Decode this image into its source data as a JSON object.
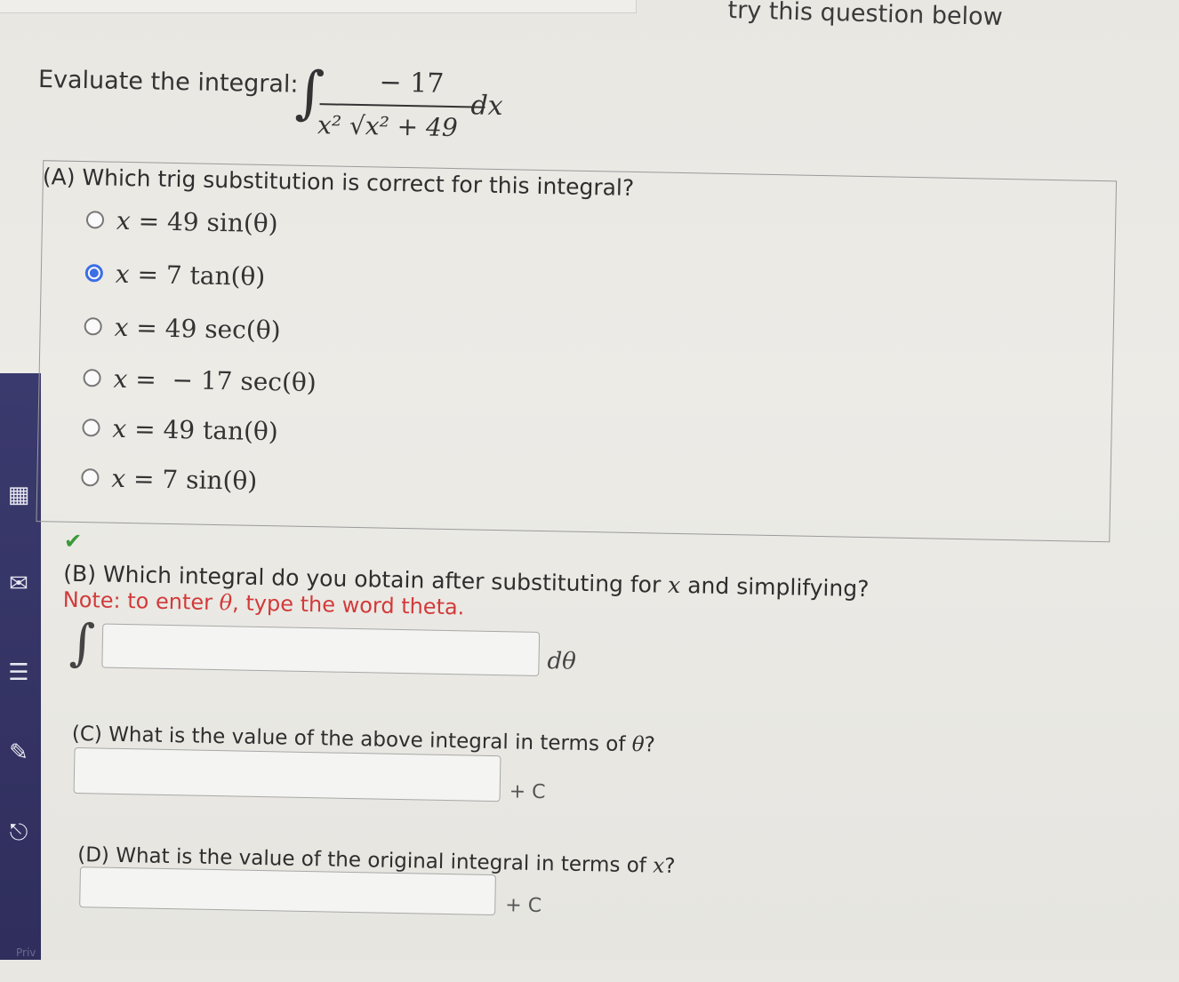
{
  "header": {
    "retry_note": "try this question below"
  },
  "problem": {
    "prompt": "Evaluate the integral:",
    "integral_sign": "∫",
    "numerator": "− 17",
    "denominator": "x² √x² + 49",
    "differential": "dx"
  },
  "part_a": {
    "question": "(A) Which trig substitution is correct for this integral?",
    "options": [
      {
        "lhs": "x",
        "rhs": "49 sin(θ)",
        "selected": false
      },
      {
        "lhs": "x",
        "rhs": "7 tan(θ)",
        "selected": true
      },
      {
        "lhs": "x",
        "rhs": "49 sec(θ)",
        "selected": false
      },
      {
        "lhs": "x",
        "rhs": "− 17 sec(θ)",
        "selected": false
      },
      {
        "lhs": "x",
        "rhs": "49 tan(θ)",
        "selected": false
      },
      {
        "lhs": "x",
        "rhs": "7 sin(θ)",
        "selected": false
      }
    ],
    "status_icon": "check-icon",
    "status_color": "#3a9a3a"
  },
  "part_b": {
    "question_pre": "(B) Which integral do you obtain after substituting for",
    "question_var": "x",
    "question_post": "and simplifying?",
    "note_pre": "Note: to enter",
    "note_var": "θ",
    "note_post": ", type the word theta.",
    "integral_sign": "∫",
    "input_value": "",
    "suffix": "dθ"
  },
  "part_c": {
    "question_pre": "(C) What is the value of the above integral in terms of",
    "question_var": "θ",
    "question_post": "?",
    "input_value": "",
    "suffix": "+ C"
  },
  "part_d": {
    "question_pre": "(D) What is the value of the original integral in terms of",
    "question_var": "x",
    "question_post": "?",
    "input_value": "",
    "suffix": "+ C"
  },
  "sidebar": {
    "footer_text": "Priv"
  },
  "colors": {
    "accent": "#3c6ee6",
    "note": "#d23a3a",
    "sidebar": "#3b3a6e"
  }
}
